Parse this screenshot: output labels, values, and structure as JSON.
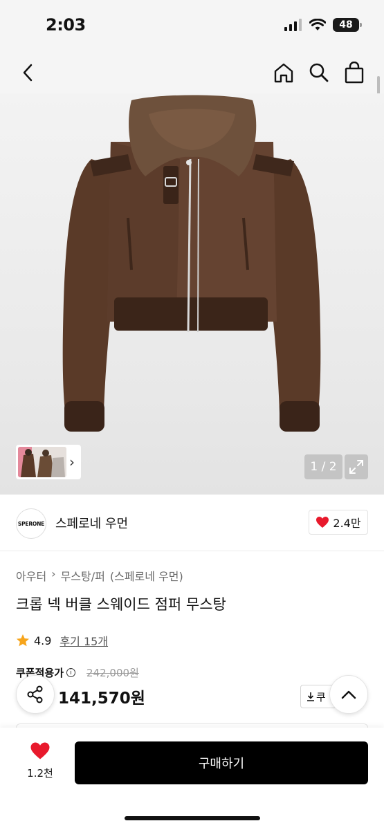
{
  "status_bar": {
    "time": "2:03",
    "battery": "48"
  },
  "nav": {
    "icons": [
      "back-icon",
      "home-icon",
      "search-icon",
      "shopping-bag-icon"
    ]
  },
  "gallery": {
    "page_counter": "1 / 2"
  },
  "brand": {
    "logo_text": "SPERONE",
    "name": "스페로네 우먼",
    "likes": "2.4만"
  },
  "product": {
    "breadcrumb": [
      "아우터",
      "무스탕/퍼",
      "(스페로네 우먼)"
    ],
    "title": "크롭 넥 버클 스웨이드 점퍼 무스탕",
    "rating": "4.9",
    "reviews": "후기 15개",
    "coupon_label": "쿠폰적용가",
    "original_price": "242,000원",
    "sale_price": "141,570원",
    "coupon_button": "쿠"
  },
  "bottom_bar": {
    "wish_count": "1.2천",
    "buy_label": "구매하기"
  },
  "colors": {
    "heart": "#e8192c",
    "star": "#f7a51c",
    "buy_button": "#000000",
    "jacket": "#5a3a28"
  }
}
